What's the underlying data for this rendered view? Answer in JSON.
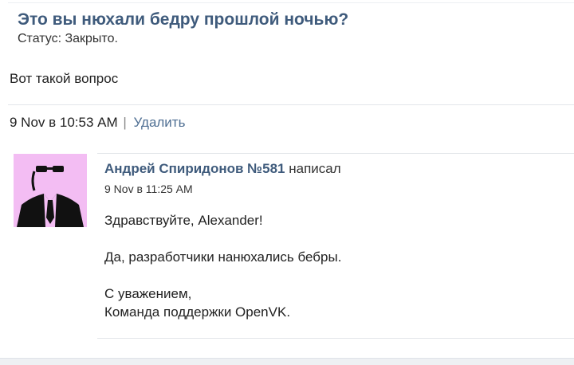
{
  "ticket": {
    "title": "Это вы нюхали бедру прошлой ночью?",
    "status": "Статус: Закрыто.",
    "text": "Вот такой вопрос",
    "date": "9 Nov в 10:53 AM",
    "separator": "|",
    "delete_label": "Удалить"
  },
  "reply": {
    "author": "Андрей Спиридонов №581",
    "action": "написал",
    "date": "9 Nov в 11:25 AM",
    "greeting": "Здравствуйте, Alexander!",
    "message": "Да, разработчики нанюхались бебры.",
    "closing_line1": "С уважением,",
    "closing_line2": "Команда поддержки OpenVK."
  },
  "colors": {
    "title": "#3f5b7c",
    "link": "#4f6f93",
    "avatar_bg": "#f3bdf3"
  }
}
